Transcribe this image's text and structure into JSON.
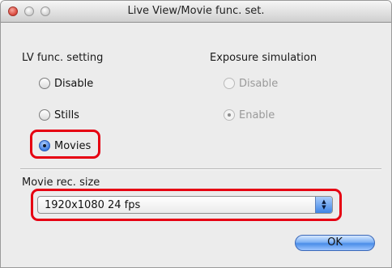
{
  "window": {
    "title": "Live View/Movie func. set."
  },
  "lv_func": {
    "label": "LV func. setting",
    "options": [
      {
        "label": "Disable",
        "selected": false
      },
      {
        "label": "Stills",
        "selected": false
      },
      {
        "label": "Movies",
        "selected": true
      }
    ]
  },
  "exposure_simulation": {
    "label": "Exposure simulation",
    "enabled": false,
    "options": [
      {
        "label": "Disable",
        "selected": false
      },
      {
        "label": "Enable",
        "selected": true
      }
    ]
  },
  "movie_rec_size": {
    "label": "Movie rec. size",
    "selected_value": "1920x1080 24 fps"
  },
  "buttons": {
    "ok_label": "OK"
  },
  "colors": {
    "highlight": "#e60012",
    "accent": "#3b7be0"
  }
}
